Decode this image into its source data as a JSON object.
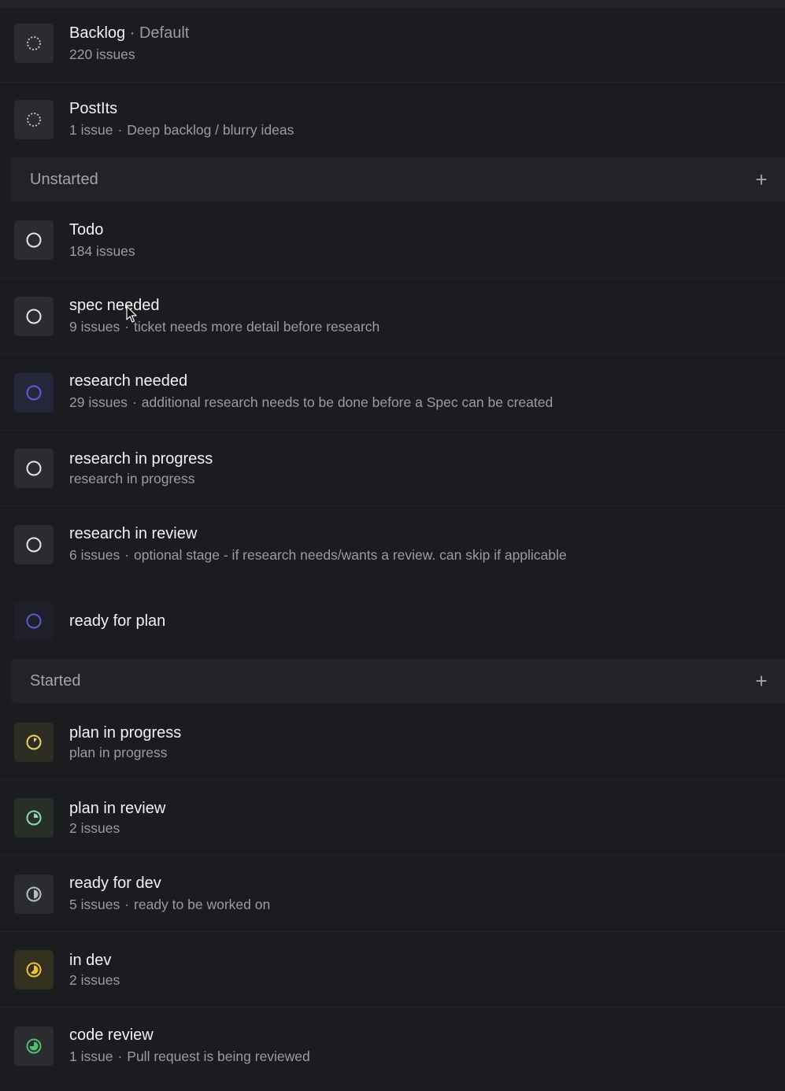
{
  "groups": {
    "backlog_rows": [
      {
        "name": "Backlog",
        "default_label": "Default",
        "count": "220 issues",
        "description": ""
      },
      {
        "name": "PostIts",
        "count": "1 issue",
        "description": "Deep backlog / blurry ideas"
      }
    ],
    "unstarted": {
      "label": "Unstarted",
      "add_symbol": "+",
      "rows": [
        {
          "name": "Todo",
          "count": "184 issues",
          "description": ""
        },
        {
          "name": "spec needed",
          "count": "9 issues",
          "description": "ticket needs more detail before research"
        },
        {
          "name": "research needed",
          "count": "29 issues",
          "description": "additional research needs to be done before a Spec can be created"
        },
        {
          "name": "research in progress",
          "count": "research in progress",
          "description": ""
        },
        {
          "name": "research in review",
          "count": "6 issues",
          "description": "optional stage - if research needs/wants a review. can skip if applicable"
        },
        {
          "name": "ready for plan",
          "count": "",
          "description": ""
        }
      ]
    },
    "started": {
      "label": "Started",
      "add_symbol": "+",
      "rows": [
        {
          "name": "plan in progress",
          "count": "plan in progress",
          "description": ""
        },
        {
          "name": "plan in review",
          "count": "2 issues",
          "description": ""
        },
        {
          "name": "ready for dev",
          "count": "5 issues",
          "description": "ready to be worked on"
        },
        {
          "name": "in dev",
          "count": "2 issues",
          "description": ""
        },
        {
          "name": "code review",
          "count": "1 issue",
          "description": "Pull request is being reviewed"
        }
      ]
    }
  },
  "separator": "·",
  "icons": {
    "backlog": "dashed-circle-icon",
    "unstarted": "empty-circle-icon",
    "started": "progress-circle-icon"
  },
  "colors": {
    "background": "#1b1c1f",
    "group_header_bg": "#222327",
    "icon_box_bg": "#2a2c30",
    "title_text": "#f2f2f4",
    "muted_text": "#9b9ca3",
    "backlog_icon": "#cfcfd3",
    "unstarted_icon": "#e6e6e8",
    "unstarted_purple": "#5b5bd6",
    "plan_in_progress": "#e8d36a",
    "plan_in_review": "#8fd8b0",
    "ready_for_dev": "#b8bcc6",
    "in_dev": "#e8c23a",
    "code_review": "#4fbf6f"
  }
}
